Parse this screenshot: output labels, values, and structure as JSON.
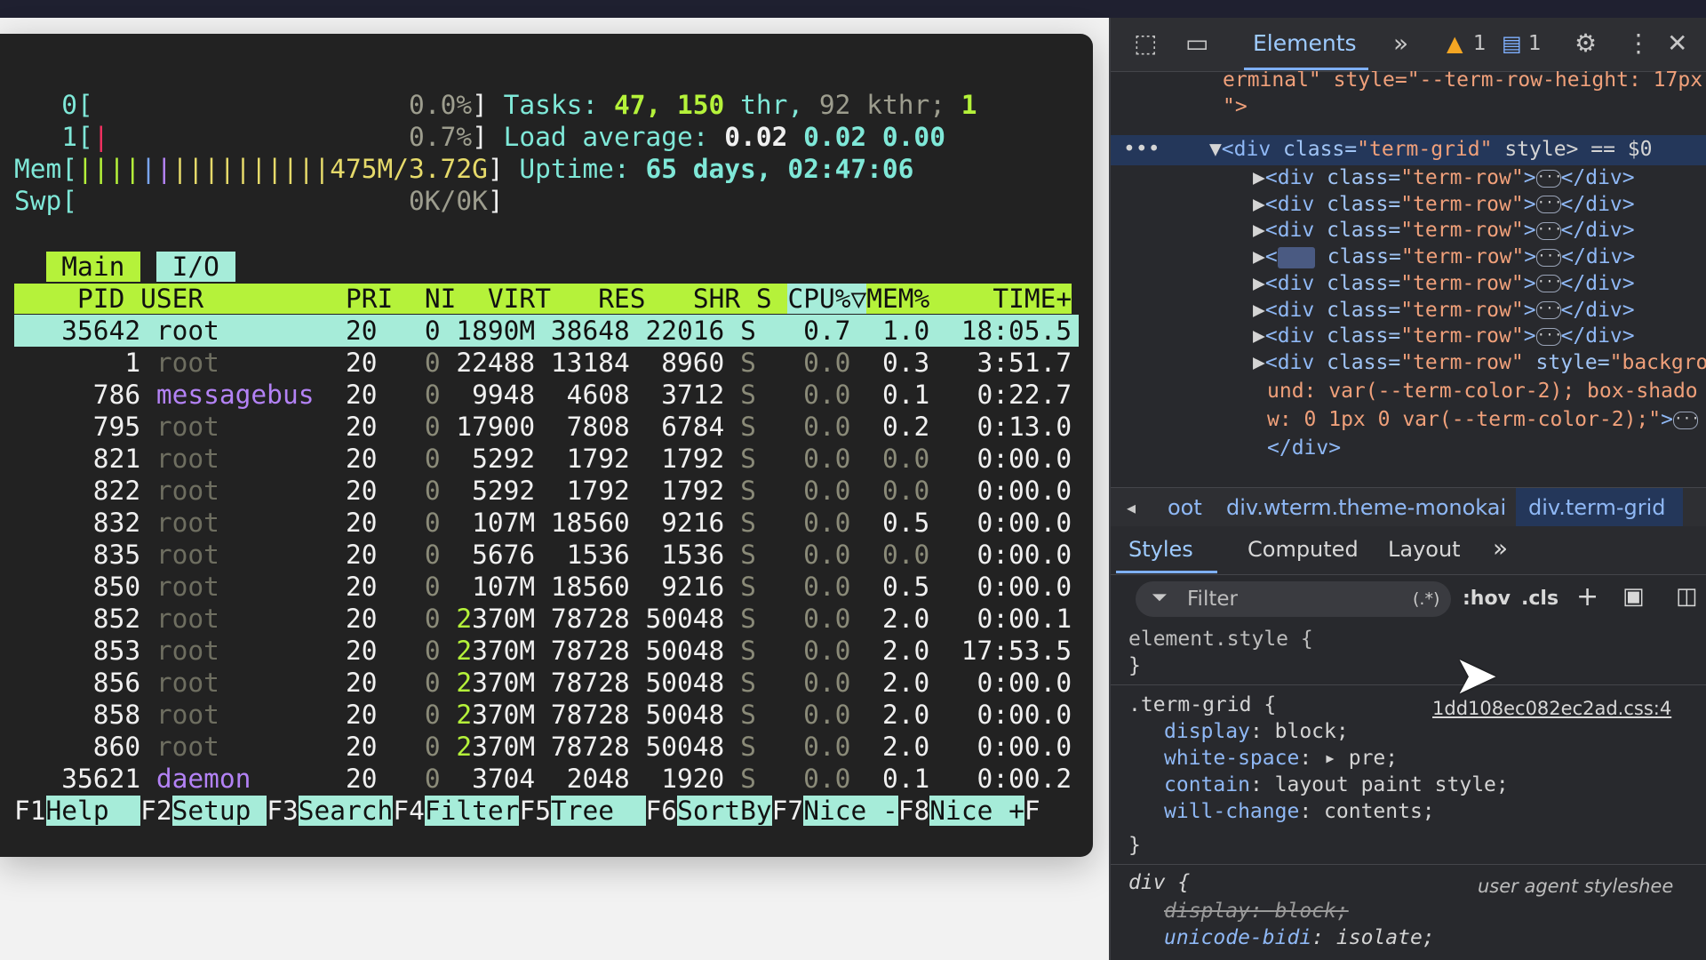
{
  "terminal": {
    "cpu0_label": "0[",
    "cpu0_pct": "0.0%",
    "cpu1_label": "1[",
    "cpu1_pct": "0.7%",
    "mem_label": "Mem[",
    "mem_value": "475M/3.72G",
    "swp_label": "Swp[",
    "swp_value": "0K/0K",
    "tasks_label": "Tasks:",
    "tasks_count": "47,",
    "thr_count": "150",
    "thr_label": "thr,",
    "kthr": "92 kthr;",
    "running": "1",
    "load_label": "Load average:",
    "load1": "0.02",
    "load5": "0.02",
    "load15": "0.00",
    "uptime_label": "Uptime:",
    "uptime_value": "65 days, 02:47:06",
    "tabs": [
      "Main",
      "I/O"
    ],
    "columns": [
      "PID",
      "USER",
      "PRI",
      "NI",
      "VIRT",
      "RES",
      "SHR",
      "S",
      "CPU%▽",
      "MEM%",
      "TIME+"
    ],
    "processes": [
      {
        "pid": "35642",
        "user": "root",
        "pri": "20",
        "ni": "0",
        "virt": "1890M",
        "res": "38648",
        "shr": "22016",
        "s": "S",
        "cpu": "0.7",
        "mem": "1.0",
        "time": "18:05.5"
      },
      {
        "pid": "1",
        "user": "root",
        "pri": "20",
        "ni": "0",
        "virt": "22488",
        "res": "13184",
        "shr": "8960",
        "s": "S",
        "cpu": "0.0",
        "mem": "0.3",
        "time": "3:51.7"
      },
      {
        "pid": "786",
        "user": "messagebus",
        "pri": "20",
        "ni": "0",
        "virt": "9948",
        "res": "4608",
        "shr": "3712",
        "s": "S",
        "cpu": "0.0",
        "mem": "0.1",
        "time": "0:22.7"
      },
      {
        "pid": "795",
        "user": "root",
        "pri": "20",
        "ni": "0",
        "virt": "17900",
        "res": "7808",
        "shr": "6784",
        "s": "S",
        "cpu": "0.0",
        "mem": "0.2",
        "time": "0:13.0"
      },
      {
        "pid": "821",
        "user": "root",
        "pri": "20",
        "ni": "0",
        "virt": "5292",
        "res": "1792",
        "shr": "1792",
        "s": "S",
        "cpu": "0.0",
        "mem": "0.0",
        "time": "0:00.0"
      },
      {
        "pid": "822",
        "user": "root",
        "pri": "20",
        "ni": "0",
        "virt": "5292",
        "res": "1792",
        "shr": "1792",
        "s": "S",
        "cpu": "0.0",
        "mem": "0.0",
        "time": "0:00.0"
      },
      {
        "pid": "832",
        "user": "root",
        "pri": "20",
        "ni": "0",
        "virt": "107M",
        "res": "18560",
        "shr": "9216",
        "s": "S",
        "cpu": "0.0",
        "mem": "0.5",
        "time": "0:00.0"
      },
      {
        "pid": "835",
        "user": "root",
        "pri": "20",
        "ni": "0",
        "virt": "5676",
        "res": "1536",
        "shr": "1536",
        "s": "S",
        "cpu": "0.0",
        "mem": "0.0",
        "time": "0:00.0"
      },
      {
        "pid": "850",
        "user": "root",
        "pri": "20",
        "ni": "0",
        "virt": "107M",
        "res": "18560",
        "shr": "9216",
        "s": "S",
        "cpu": "0.0",
        "mem": "0.5",
        "time": "0:00.0"
      },
      {
        "pid": "852",
        "user": "root",
        "pri": "20",
        "ni": "0",
        "virt": "2370M",
        "res": "78728",
        "shr": "50048",
        "s": "S",
        "cpu": "0.0",
        "mem": "2.0",
        "time": "0:00.1"
      },
      {
        "pid": "853",
        "user": "root",
        "pri": "20",
        "ni": "0",
        "virt": "2370M",
        "res": "78728",
        "shr": "50048",
        "s": "S",
        "cpu": "0.0",
        "mem": "2.0",
        "time": "17:53.5"
      },
      {
        "pid": "856",
        "user": "root",
        "pri": "20",
        "ni": "0",
        "virt": "2370M",
        "res": "78728",
        "shr": "50048",
        "s": "S",
        "cpu": "0.0",
        "mem": "2.0",
        "time": "0:00.0"
      },
      {
        "pid": "858",
        "user": "root",
        "pri": "20",
        "ni": "0",
        "virt": "2370M",
        "res": "78728",
        "shr": "50048",
        "s": "S",
        "cpu": "0.0",
        "mem": "2.0",
        "time": "0:00.0"
      },
      {
        "pid": "860",
        "user": "root",
        "pri": "20",
        "ni": "0",
        "virt": "2370M",
        "res": "78728",
        "shr": "50048",
        "s": "S",
        "cpu": "0.0",
        "mem": "2.0",
        "time": "0:00.0"
      },
      {
        "pid": "35621",
        "user": "daemon",
        "pri": "20",
        "ni": "0",
        "virt": "3704",
        "res": "2048",
        "shr": "1920",
        "s": "S",
        "cpu": "0.0",
        "mem": "0.1",
        "time": "0:00.2"
      }
    ],
    "fkeys": [
      {
        "key": "F1",
        "label": "Help  "
      },
      {
        "key": "F2",
        "label": "Setup "
      },
      {
        "key": "F3",
        "label": "Search"
      },
      {
        "key": "F4",
        "label": "Filter"
      },
      {
        "key": "F5",
        "label": "Tree  "
      },
      {
        "key": "F6",
        "label": "SortBy"
      },
      {
        "key": "F7",
        "label": "Nice -"
      },
      {
        "key": "F8",
        "label": "Nice +"
      },
      {
        "key": "F",
        "label": ""
      }
    ]
  },
  "devtools": {
    "elements_tab": "Elements",
    "warning_count": "1",
    "message_count": "1",
    "tree_line0": "erminal\" style=\"--term-row-height: 17px",
    "tree_line1": "\">",
    "selected_line_tag": "<div ",
    "selected_line_attr": "class=",
    "selected_line_val": "\"term-grid\"",
    "selected_line_rest": " style> == $0",
    "row_tag": "<div ",
    "row_attr": "class=",
    "row_val": "\"term-row\"",
    "row_close": "</div>",
    "row8_style_attr": " style=",
    "row8_style_val1": "\"backgro",
    "row8_style_val2": "und: var(--term-color-2); box-shado",
    "row8_style_val3": "w: 0 1px 0 var(--term-color-2);\"",
    "row8_gt": ">",
    "row8_close": "</div>",
    "breadcrumb": [
      "oot",
      "div.wterm.theme-monokai",
      "div.term-grid"
    ],
    "styles_tabs": [
      "Styles",
      "Computed",
      "Layout"
    ],
    "filter_placeholder": "Filter",
    "filter_regex": "(.*)",
    "hov": ":hov",
    "cls": ".cls",
    "element_style": "element.style {",
    "close_brace": "}",
    "rule_selector": ".term-grid {",
    "rule_source": "1dd108ec082ec2ad.css:4",
    "rule_props": [
      {
        "name": "display",
        "value": "block;"
      },
      {
        "name": "white-space",
        "value": "pre;"
      },
      {
        "name": "contain",
        "value": "layout paint style;"
      },
      {
        "name": "will-change",
        "value": "contents;"
      }
    ],
    "ua_selector": "div {",
    "ua_source": "user agent styleshee",
    "ua_prop1_name": "display",
    "ua_prop1_value": "block;",
    "ua_prop2_name": "unicode-bidi",
    "ua_prop2_value": "isolate;"
  }
}
